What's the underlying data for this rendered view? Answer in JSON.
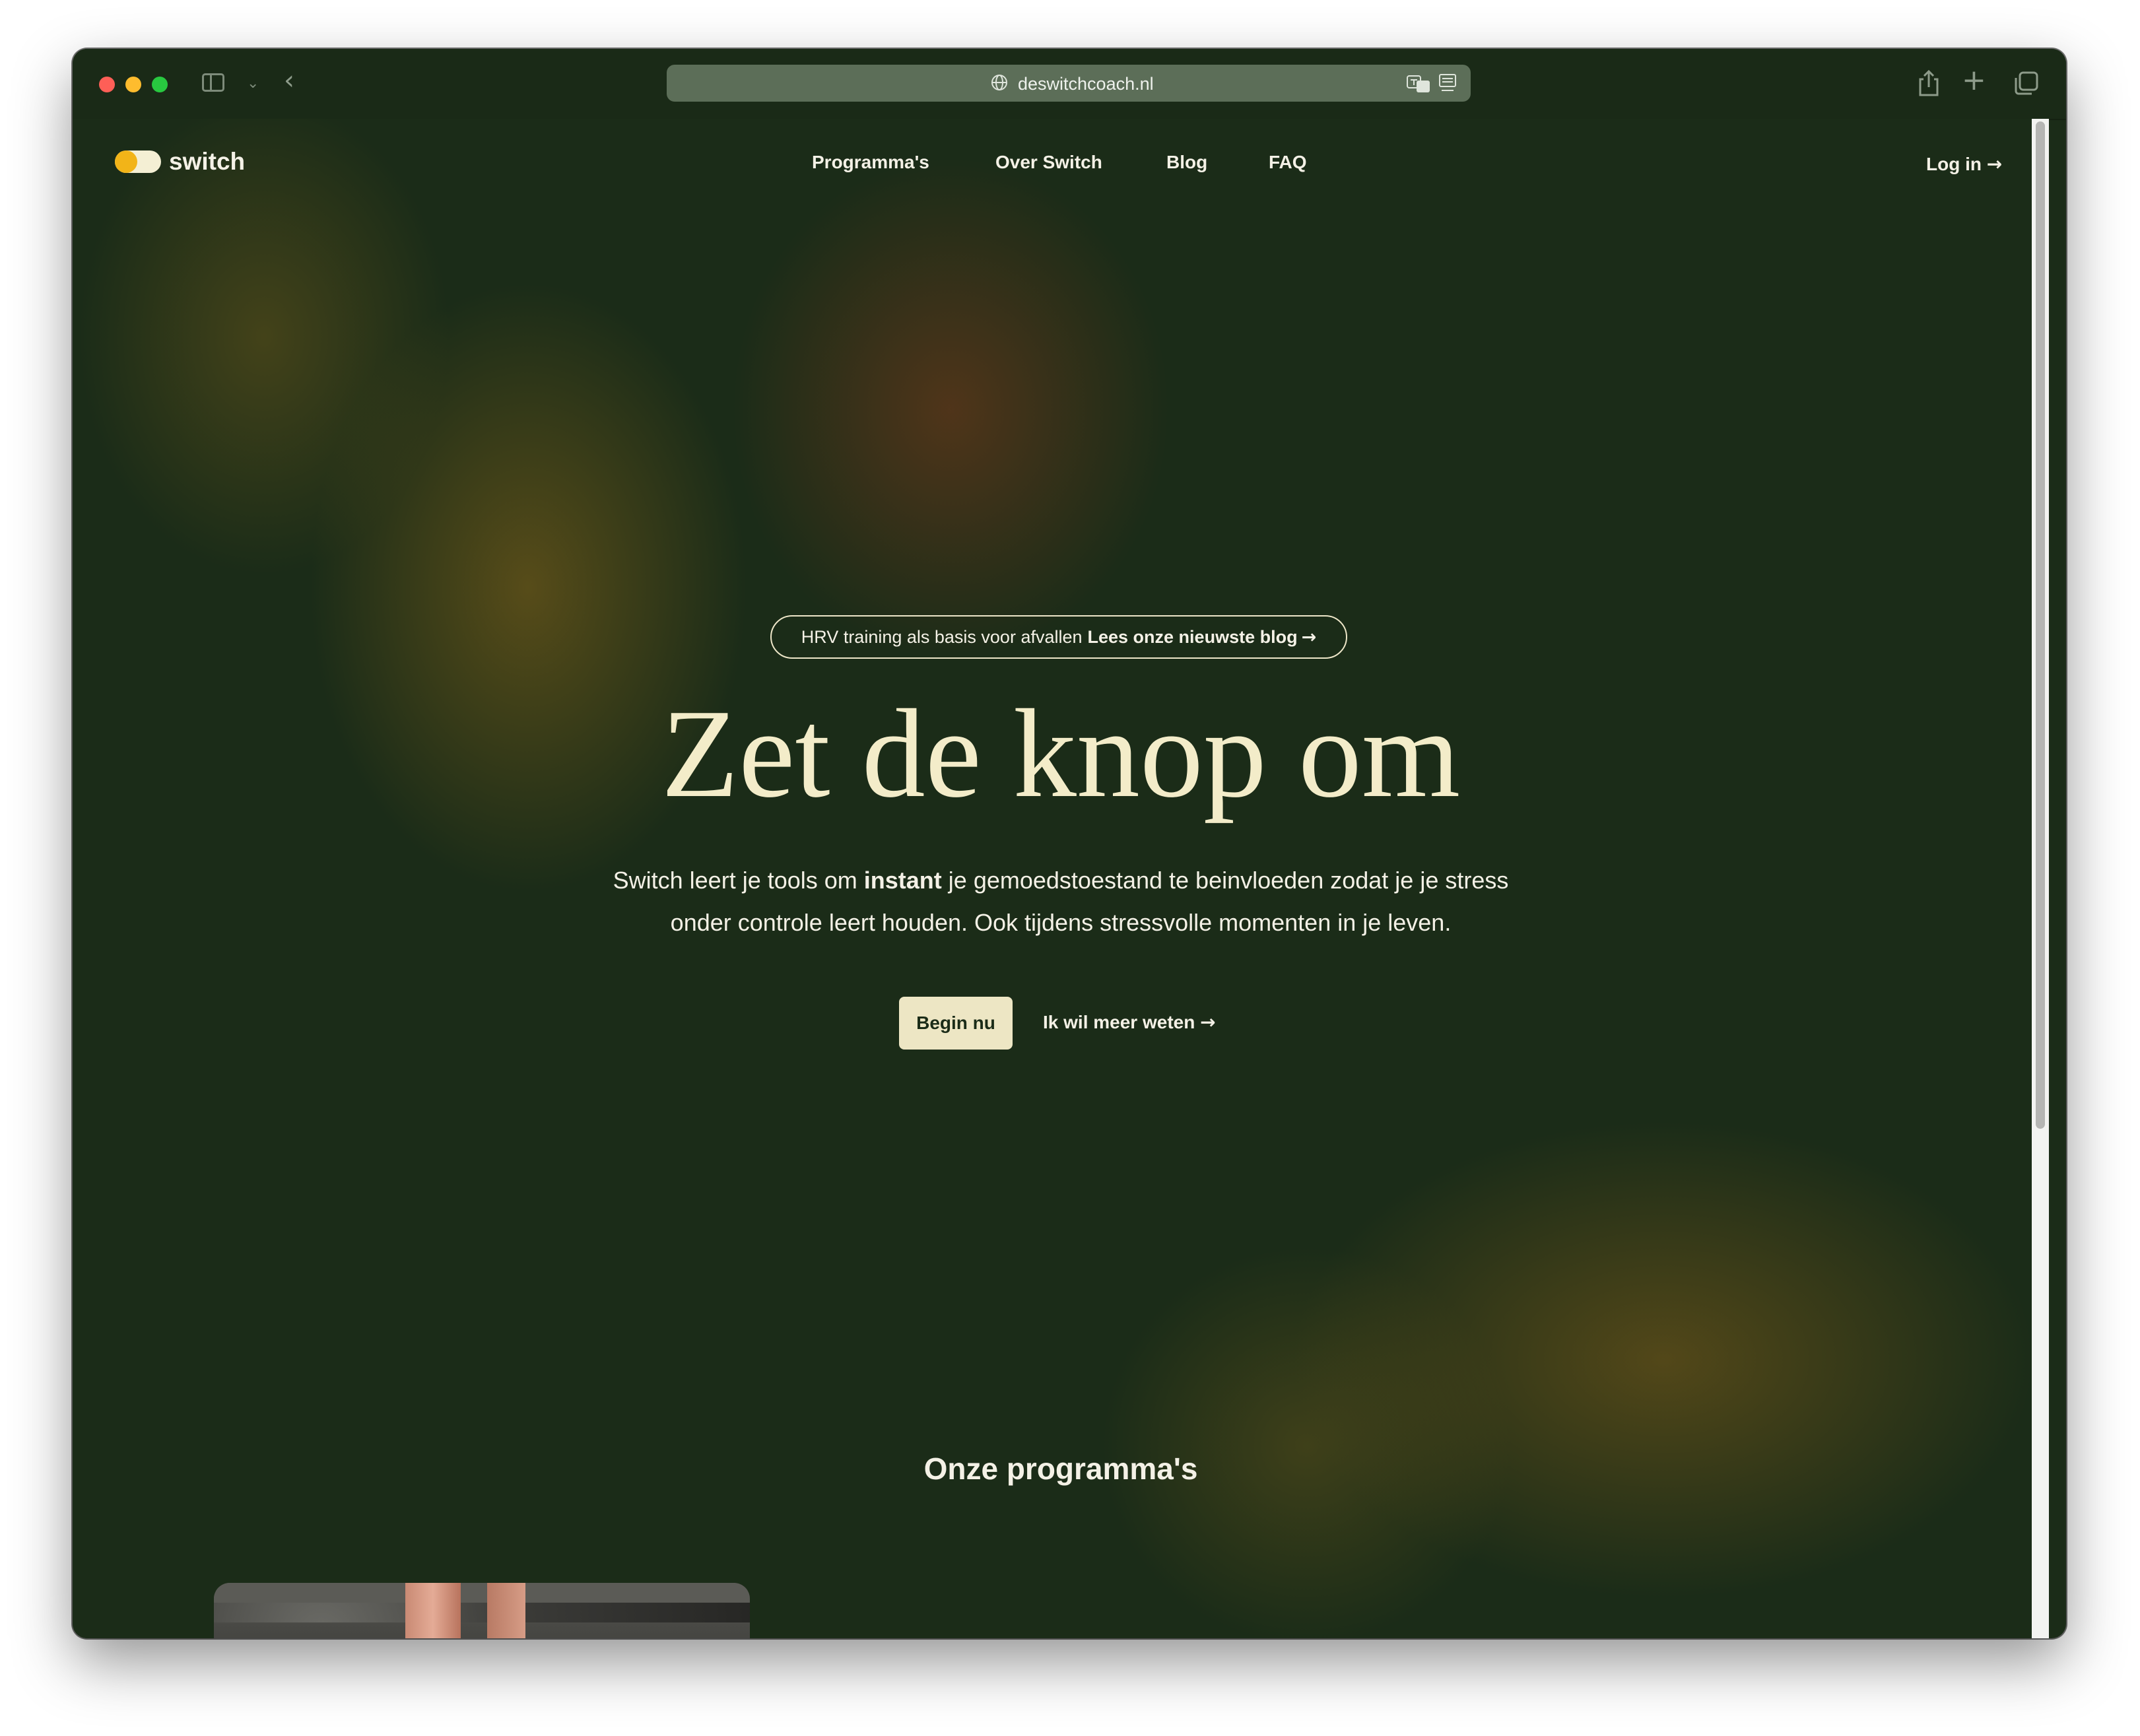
{
  "browser": {
    "url": "deswitchcoach.nl"
  },
  "site": {
    "logo_text": "switch",
    "nav": {
      "programmas": "Programma's",
      "over": "Over Switch",
      "blog": "Blog",
      "faq": "FAQ"
    },
    "login": "Log in"
  },
  "hero": {
    "announcement_text": "HRV training als basis voor afvallen",
    "announcement_link": "Lees onze nieuwste blog",
    "title": "Zet de knop om",
    "subtitle_before": "Switch leert je tools om ",
    "subtitle_bold": "instant",
    "subtitle_after": " je gemoedstoestand te beinvloeden zodat je je stress onder controle leert houden. Ook tijdens stressvolle momenten in je leven.",
    "cta_primary": "Begin nu",
    "cta_secondary": "Ik wil meer weten"
  },
  "programs": {
    "title": "Onze programma's"
  },
  "icons": {
    "arrow": "→",
    "chevron_down": "⌄",
    "back": "‹",
    "plus": "+"
  },
  "colors": {
    "background": "#1b2c18",
    "accent_yellow": "#f2b418",
    "cream": "#f3ecc9",
    "button": "#ede6c4"
  }
}
